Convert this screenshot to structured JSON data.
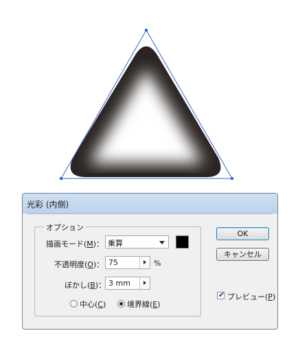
{
  "colors": {
    "anchor": "#3366cc",
    "shape_edge": "#2a2522",
    "shape_center": "#ffffff",
    "glow_swatch": "#000000",
    "titlebar": "#c7dbf1"
  },
  "dialog": {
    "title": "光彩 (内側)",
    "options": {
      "legend": "オプション",
      "mode": {
        "label": "描画モード(",
        "key": "M",
        "label_end": ")：",
        "value": "乗算"
      },
      "opacity": {
        "label": "不透明度(",
        "key": "O",
        "label_end": ")：",
        "value": "75",
        "unit": "%"
      },
      "blur": {
        "label": "ぼかし(",
        "key": "B",
        "label_end": ")：",
        "value": "3 mm"
      },
      "center": {
        "label": "中心(",
        "key": "C",
        "label_end": ")",
        "selected": false
      },
      "edge": {
        "label": "境界線(",
        "key": "E",
        "label_end": ")",
        "selected": true
      }
    },
    "buttons": {
      "ok": "OK",
      "cancel": "キャンセル"
    },
    "preview": {
      "label": "プレビュー(",
      "key": "P",
      "label_end": ")",
      "checked": true
    }
  }
}
